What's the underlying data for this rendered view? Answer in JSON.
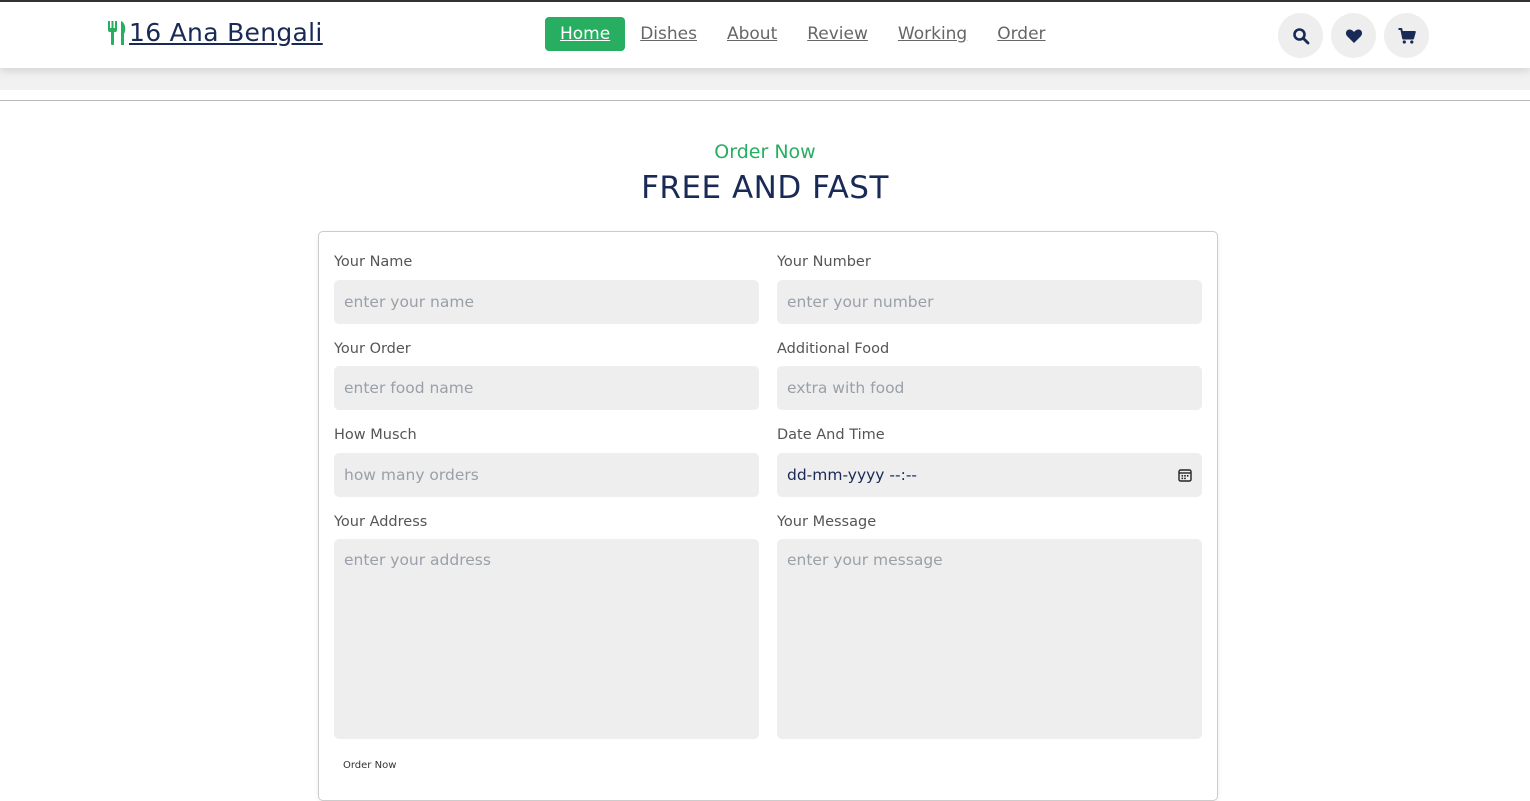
{
  "header": {
    "logo_text": "16 Ana Bengali",
    "nav": [
      {
        "label": "Home",
        "active": true
      },
      {
        "label": "Dishes"
      },
      {
        "label": "About"
      },
      {
        "label": "Review"
      },
      {
        "label": "Working"
      },
      {
        "label": "Order"
      }
    ],
    "icons": [
      "search-icon",
      "heart-icon",
      "cart-icon"
    ]
  },
  "section": {
    "subtitle": "Order Now",
    "title": "FREE AND FAST"
  },
  "form": {
    "name": {
      "label": "Your Name",
      "placeholder": "enter your name"
    },
    "number": {
      "label": "Your Number",
      "placeholder": "enter your number"
    },
    "order": {
      "label": "Your Order",
      "placeholder": "enter food name"
    },
    "additional": {
      "label": "Additional Food",
      "placeholder": "extra with food"
    },
    "quantity": {
      "label": "How Musch",
      "placeholder": "how many orders"
    },
    "datetime": {
      "label": "Date And Time",
      "value": "dd-mm-yyyy --:--"
    },
    "address": {
      "label": "Your Address",
      "placeholder": "enter your address"
    },
    "message": {
      "label": "Your Message",
      "placeholder": "enter your message"
    },
    "submit_label": "Order Now"
  },
  "colors": {
    "accent": "#27ae60",
    "text_dark": "#192a56",
    "field_bg": "#eeeeee"
  }
}
